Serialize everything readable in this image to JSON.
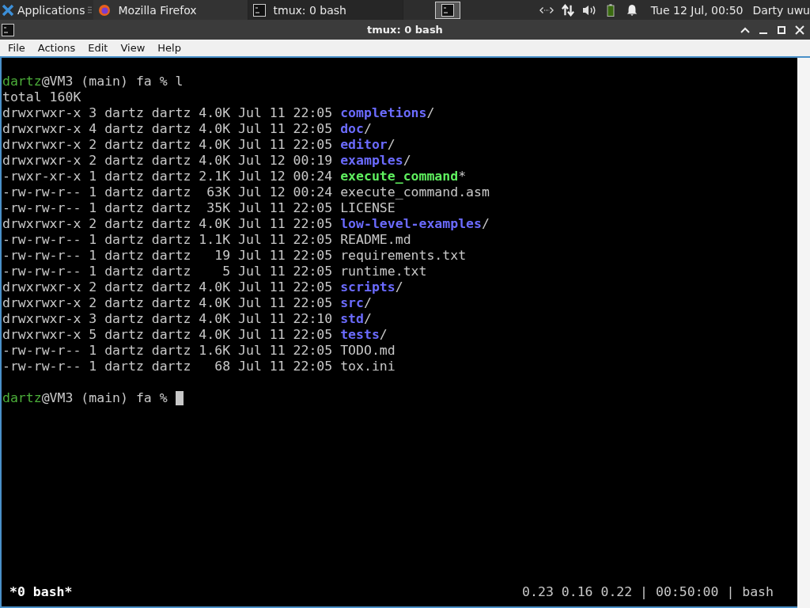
{
  "panel": {
    "apps_label": "Applications",
    "tasks": [
      {
        "label": "Mozilla Firefox",
        "kind": "browser",
        "selected": false
      },
      {
        "label": "tmux: 0 bash",
        "kind": "terminal",
        "selected": true
      }
    ],
    "clock": "Tue 12 Jul, 00:50",
    "user": "Darty uwu"
  },
  "window": {
    "title": "tmux: 0 bash"
  },
  "menu": [
    "File",
    "Actions",
    "Edit",
    "View",
    "Help"
  ],
  "terminal": {
    "lines": [
      {
        "kind": "prompt",
        "user": "dartz",
        "rest": "@VM3 (main) fa % l",
        "cursor": false
      },
      {
        "kind": "text",
        "text": "total 160K"
      },
      {
        "kind": "dir",
        "meta": "drwxrwxr-x 3 dartz dartz 4.0K Jul 11 22:05 ",
        "name": "completions",
        "suffix": "/"
      },
      {
        "kind": "dir",
        "meta": "drwxrwxr-x 4 dartz dartz 4.0K Jul 11 22:05 ",
        "name": "doc",
        "suffix": "/"
      },
      {
        "kind": "dir",
        "meta": "drwxrwxr-x 2 dartz dartz 4.0K Jul 11 22:05 ",
        "name": "editor",
        "suffix": "/"
      },
      {
        "kind": "dir",
        "meta": "drwxrwxr-x 2 dartz dartz 4.0K Jul 12 00:19 ",
        "name": "examples",
        "suffix": "/"
      },
      {
        "kind": "exec",
        "meta": "-rwxr-xr-x 1 dartz dartz 2.1K Jul 12 00:24 ",
        "name": "execute_command",
        "suffix": "*"
      },
      {
        "kind": "file",
        "meta": "-rw-rw-r-- 1 dartz dartz  63K Jul 12 00:24 ",
        "name": "execute_command.asm"
      },
      {
        "kind": "file",
        "meta": "-rw-rw-r-- 1 dartz dartz  35K Jul 11 22:05 ",
        "name": "LICENSE"
      },
      {
        "kind": "dir",
        "meta": "drwxrwxr-x 2 dartz dartz 4.0K Jul 11 22:05 ",
        "name": "low-level-examples",
        "suffix": "/"
      },
      {
        "kind": "file",
        "meta": "-rw-rw-r-- 1 dartz dartz 1.1K Jul 11 22:05 ",
        "name": "README.md"
      },
      {
        "kind": "file",
        "meta": "-rw-rw-r-- 1 dartz dartz   19 Jul 11 22:05 ",
        "name": "requirements.txt"
      },
      {
        "kind": "file",
        "meta": "-rw-rw-r-- 1 dartz dartz    5 Jul 11 22:05 ",
        "name": "runtime.txt"
      },
      {
        "kind": "dir",
        "meta": "drwxrwxr-x 2 dartz dartz 4.0K Jul 11 22:05 ",
        "name": "scripts",
        "suffix": "/"
      },
      {
        "kind": "dir",
        "meta": "drwxrwxr-x 2 dartz dartz 4.0K Jul 11 22:05 ",
        "name": "src",
        "suffix": "/"
      },
      {
        "kind": "dir",
        "meta": "drwxrwxr-x 3 dartz dartz 4.0K Jul 11 22:10 ",
        "name": "std",
        "suffix": "/"
      },
      {
        "kind": "dir",
        "meta": "drwxrwxr-x 5 dartz dartz 4.0K Jul 11 22:05 ",
        "name": "tests",
        "suffix": "/"
      },
      {
        "kind": "file",
        "meta": "-rw-rw-r-- 1 dartz dartz 1.6K Jul 11 22:05 ",
        "name": "TODO.md"
      },
      {
        "kind": "file",
        "meta": "-rw-rw-r-- 1 dartz dartz   68 Jul 11 22:05 ",
        "name": "tox.ini"
      },
      {
        "kind": "blank"
      },
      {
        "kind": "prompt",
        "user": "dartz",
        "rest": "@VM3 (main) fa % ",
        "cursor": true
      }
    ]
  },
  "status": {
    "window": "*0 bash*",
    "right": "0.23 0.16 0.22 | 00:50:00 | bash"
  }
}
